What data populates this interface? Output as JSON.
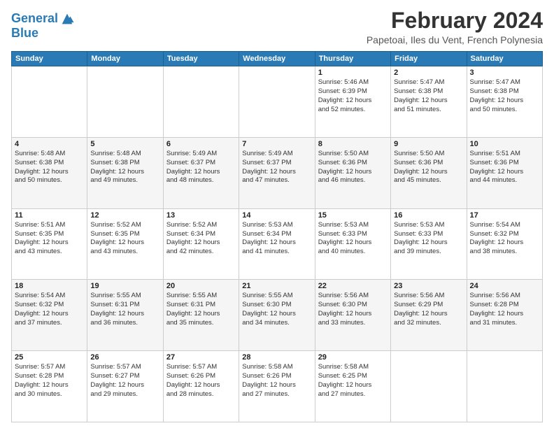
{
  "logo": {
    "line1": "General",
    "line2": "Blue"
  },
  "title": "February 2024",
  "subtitle": "Papetoai, Iles du Vent, French Polynesia",
  "days_of_week": [
    "Sunday",
    "Monday",
    "Tuesday",
    "Wednesday",
    "Thursday",
    "Friday",
    "Saturday"
  ],
  "weeks": [
    [
      {
        "day": "",
        "info": ""
      },
      {
        "day": "",
        "info": ""
      },
      {
        "day": "",
        "info": ""
      },
      {
        "day": "",
        "info": ""
      },
      {
        "day": "1",
        "info": "Sunrise: 5:46 AM\nSunset: 6:39 PM\nDaylight: 12 hours\nand 52 minutes."
      },
      {
        "day": "2",
        "info": "Sunrise: 5:47 AM\nSunset: 6:38 PM\nDaylight: 12 hours\nand 51 minutes."
      },
      {
        "day": "3",
        "info": "Sunrise: 5:47 AM\nSunset: 6:38 PM\nDaylight: 12 hours\nand 50 minutes."
      }
    ],
    [
      {
        "day": "4",
        "info": "Sunrise: 5:48 AM\nSunset: 6:38 PM\nDaylight: 12 hours\nand 50 minutes."
      },
      {
        "day": "5",
        "info": "Sunrise: 5:48 AM\nSunset: 6:38 PM\nDaylight: 12 hours\nand 49 minutes."
      },
      {
        "day": "6",
        "info": "Sunrise: 5:49 AM\nSunset: 6:37 PM\nDaylight: 12 hours\nand 48 minutes."
      },
      {
        "day": "7",
        "info": "Sunrise: 5:49 AM\nSunset: 6:37 PM\nDaylight: 12 hours\nand 47 minutes."
      },
      {
        "day": "8",
        "info": "Sunrise: 5:50 AM\nSunset: 6:36 PM\nDaylight: 12 hours\nand 46 minutes."
      },
      {
        "day": "9",
        "info": "Sunrise: 5:50 AM\nSunset: 6:36 PM\nDaylight: 12 hours\nand 45 minutes."
      },
      {
        "day": "10",
        "info": "Sunrise: 5:51 AM\nSunset: 6:36 PM\nDaylight: 12 hours\nand 44 minutes."
      }
    ],
    [
      {
        "day": "11",
        "info": "Sunrise: 5:51 AM\nSunset: 6:35 PM\nDaylight: 12 hours\nand 43 minutes."
      },
      {
        "day": "12",
        "info": "Sunrise: 5:52 AM\nSunset: 6:35 PM\nDaylight: 12 hours\nand 43 minutes."
      },
      {
        "day": "13",
        "info": "Sunrise: 5:52 AM\nSunset: 6:34 PM\nDaylight: 12 hours\nand 42 minutes."
      },
      {
        "day": "14",
        "info": "Sunrise: 5:53 AM\nSunset: 6:34 PM\nDaylight: 12 hours\nand 41 minutes."
      },
      {
        "day": "15",
        "info": "Sunrise: 5:53 AM\nSunset: 6:33 PM\nDaylight: 12 hours\nand 40 minutes."
      },
      {
        "day": "16",
        "info": "Sunrise: 5:53 AM\nSunset: 6:33 PM\nDaylight: 12 hours\nand 39 minutes."
      },
      {
        "day": "17",
        "info": "Sunrise: 5:54 AM\nSunset: 6:32 PM\nDaylight: 12 hours\nand 38 minutes."
      }
    ],
    [
      {
        "day": "18",
        "info": "Sunrise: 5:54 AM\nSunset: 6:32 PM\nDaylight: 12 hours\nand 37 minutes."
      },
      {
        "day": "19",
        "info": "Sunrise: 5:55 AM\nSunset: 6:31 PM\nDaylight: 12 hours\nand 36 minutes."
      },
      {
        "day": "20",
        "info": "Sunrise: 5:55 AM\nSunset: 6:31 PM\nDaylight: 12 hours\nand 35 minutes."
      },
      {
        "day": "21",
        "info": "Sunrise: 5:55 AM\nSunset: 6:30 PM\nDaylight: 12 hours\nand 34 minutes."
      },
      {
        "day": "22",
        "info": "Sunrise: 5:56 AM\nSunset: 6:30 PM\nDaylight: 12 hours\nand 33 minutes."
      },
      {
        "day": "23",
        "info": "Sunrise: 5:56 AM\nSunset: 6:29 PM\nDaylight: 12 hours\nand 32 minutes."
      },
      {
        "day": "24",
        "info": "Sunrise: 5:56 AM\nSunset: 6:28 PM\nDaylight: 12 hours\nand 31 minutes."
      }
    ],
    [
      {
        "day": "25",
        "info": "Sunrise: 5:57 AM\nSunset: 6:28 PM\nDaylight: 12 hours\nand 30 minutes."
      },
      {
        "day": "26",
        "info": "Sunrise: 5:57 AM\nSunset: 6:27 PM\nDaylight: 12 hours\nand 29 minutes."
      },
      {
        "day": "27",
        "info": "Sunrise: 5:57 AM\nSunset: 6:26 PM\nDaylight: 12 hours\nand 28 minutes."
      },
      {
        "day": "28",
        "info": "Sunrise: 5:58 AM\nSunset: 6:26 PM\nDaylight: 12 hours\nand 27 minutes."
      },
      {
        "day": "29",
        "info": "Sunrise: 5:58 AM\nSunset: 6:25 PM\nDaylight: 12 hours\nand 27 minutes."
      },
      {
        "day": "",
        "info": ""
      },
      {
        "day": "",
        "info": ""
      }
    ]
  ]
}
